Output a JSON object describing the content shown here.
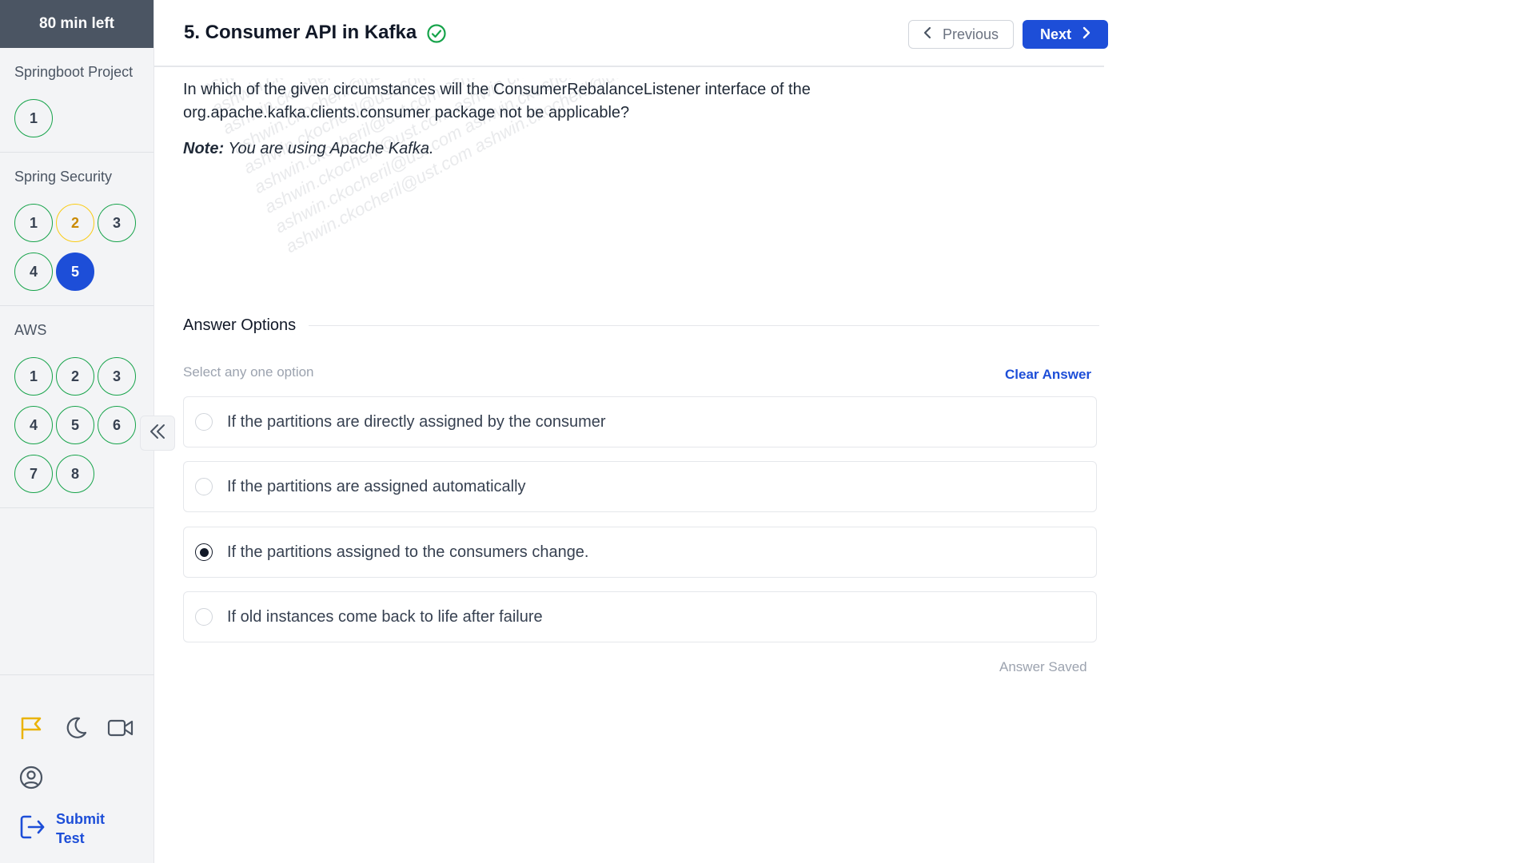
{
  "timer": "80 min left",
  "sections": [
    {
      "title": "Springboot Project",
      "questions": [
        {
          "n": "1",
          "state": "answered"
        }
      ]
    },
    {
      "title": "Spring Security",
      "questions": [
        {
          "n": "1",
          "state": "answered"
        },
        {
          "n": "2",
          "state": "review"
        },
        {
          "n": "3",
          "state": "answered"
        },
        {
          "n": "4",
          "state": "answered"
        },
        {
          "n": "5",
          "state": "current"
        }
      ]
    },
    {
      "title": "AWS",
      "questions": [
        {
          "n": "1",
          "state": "answered"
        },
        {
          "n": "2",
          "state": "answered"
        },
        {
          "n": "3",
          "state": "answered"
        },
        {
          "n": "4",
          "state": "answered"
        },
        {
          "n": "5",
          "state": "answered"
        },
        {
          "n": "6",
          "state": "answered"
        },
        {
          "n": "7",
          "state": "answered"
        },
        {
          "n": "8",
          "state": "answered"
        }
      ]
    }
  ],
  "sidebar_tools": [
    "flag-icon",
    "moon-icon",
    "video-icon",
    "user-circle-icon"
  ],
  "submit_label": "Submit Test",
  "header": {
    "question_title": "5. Consumer API in Kafka",
    "prev_label": "Previous",
    "next_label": "Next"
  },
  "question": {
    "text": "In which of the given circumstances will the ConsumerRebalanceListener interface of the org.apache.kafka.clients.consumer package not be applicable?",
    "note_label": "Note:",
    "note_text": "You are using Apache Kafka.",
    "watermark": "ashwin.ckocheril@ust.com"
  },
  "answers": {
    "title": "Answer Options",
    "hint": "Select any one option",
    "clear_label": "Clear Answer",
    "options": [
      {
        "text": "If the partitions are directly assigned by the consumer",
        "selected": false
      },
      {
        "text": "If the partitions are assigned automatically",
        "selected": false
      },
      {
        "text": "If the partitions assigned to the consumers change.",
        "selected": true
      },
      {
        "text": "If old instances come back to life after failure",
        "selected": false
      }
    ],
    "status": "Answer Saved"
  },
  "colors": {
    "accent": "#1d4ed8",
    "answered": "#16a34a",
    "review": "#facc15",
    "flag": "#eab308"
  }
}
